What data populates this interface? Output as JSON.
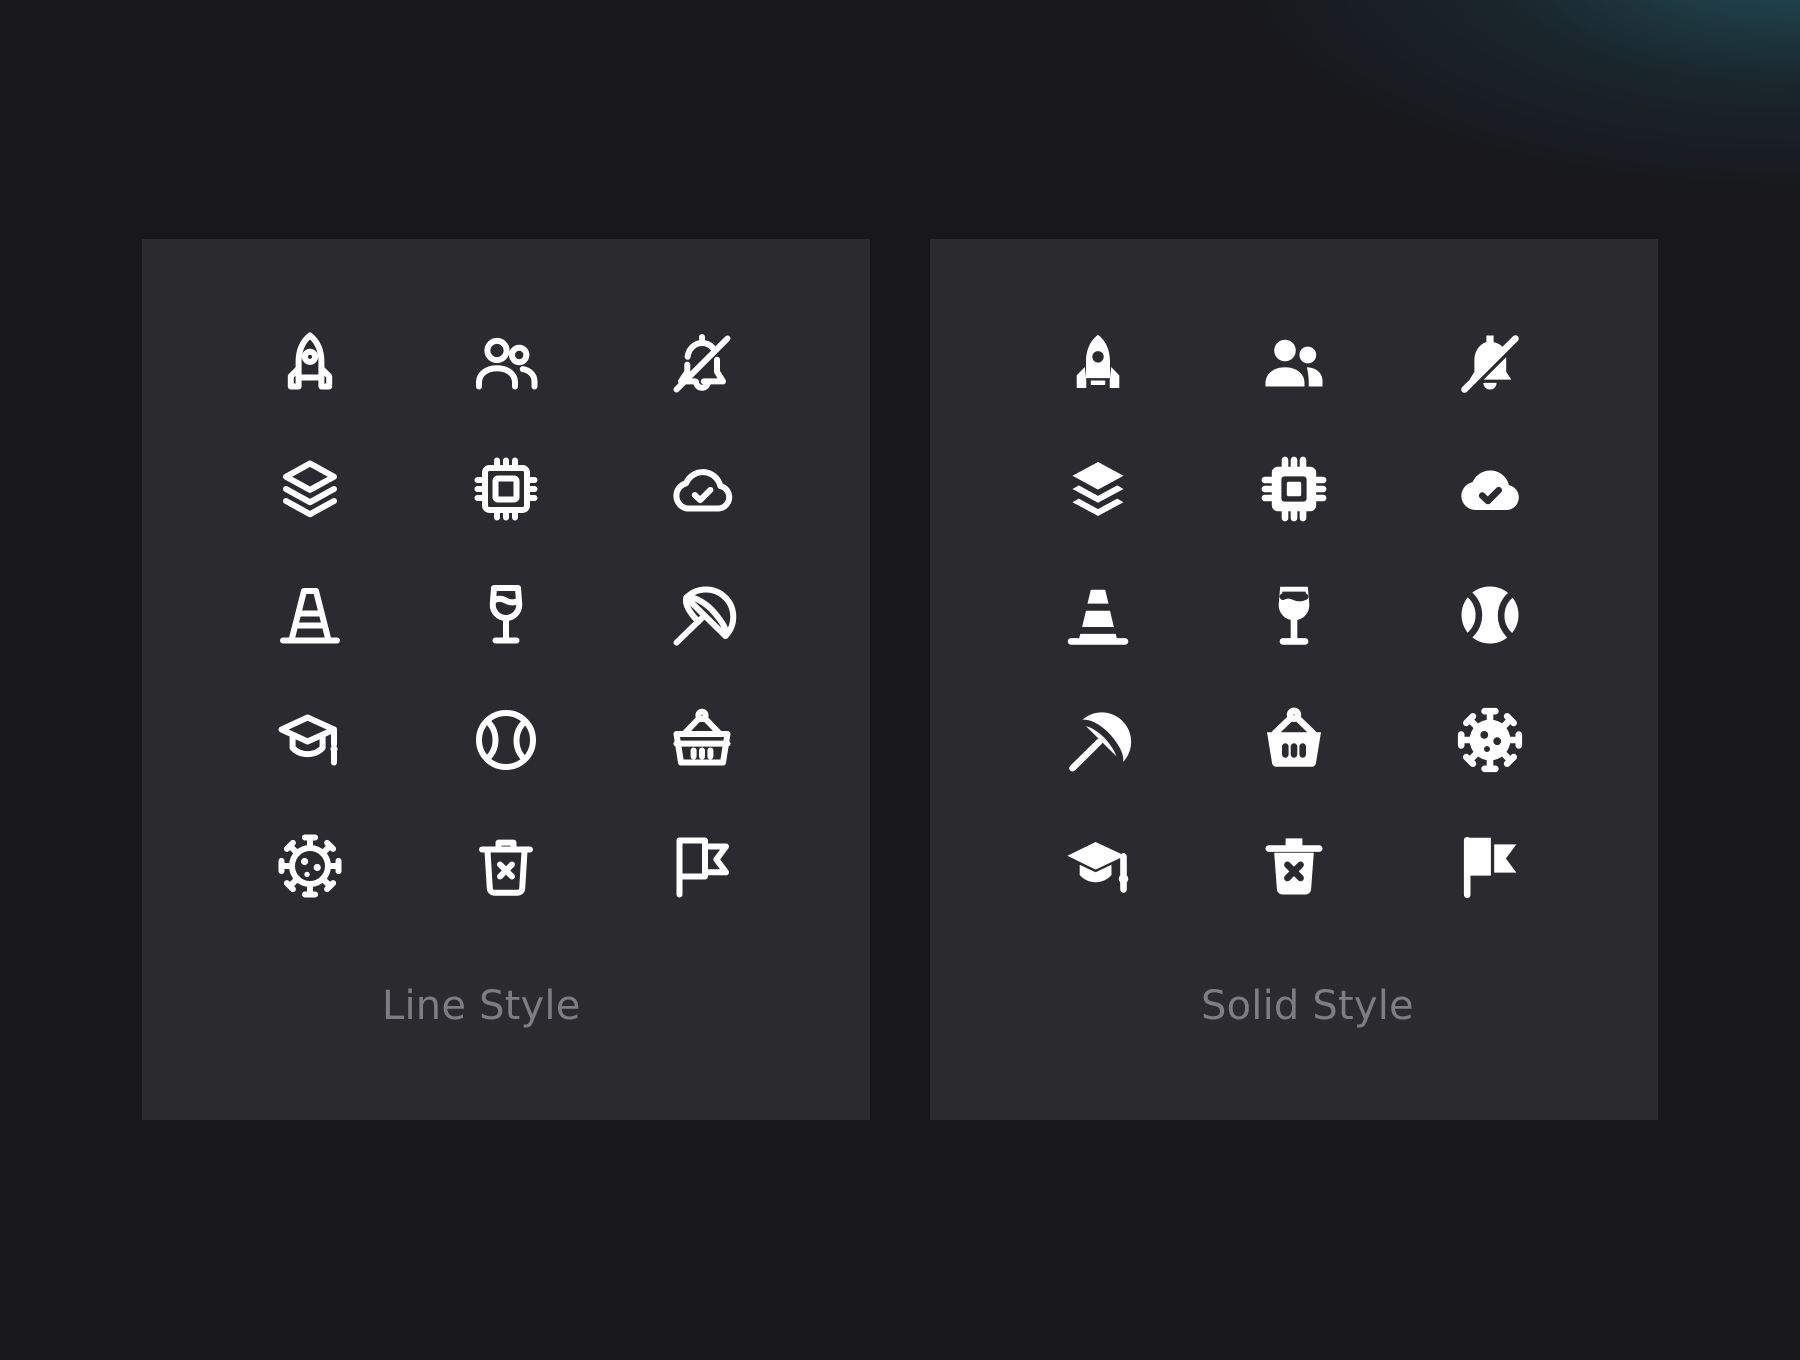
{
  "panels": {
    "line": {
      "label": "Line Style",
      "icons": [
        "rocket-icon",
        "users-icon",
        "bell-off-icon",
        "layers-icon",
        "cpu-chip-icon",
        "cloud-check-icon",
        "traffic-cone-icon",
        "wine-glass-icon",
        "beach-umbrella-icon",
        "graduation-cap-icon",
        "tennis-ball-icon",
        "basket-icon",
        "virus-icon",
        "trash-x-icon",
        "flag-icon"
      ]
    },
    "solid": {
      "label": "Solid Style",
      "icons": [
        "rocket-icon",
        "users-icon",
        "bell-off-icon",
        "layers-icon",
        "cpu-chip-icon",
        "cloud-check-icon",
        "traffic-cone-icon",
        "wine-glass-icon",
        "tennis-ball-icon",
        "beach-umbrella-icon",
        "basket-icon",
        "virus-icon",
        "graduation-cap-icon",
        "trash-x-icon",
        "flag-icon"
      ]
    }
  },
  "colors": {
    "background": "#18181c",
    "card": "#2a2a2f",
    "icon": "#ffffff",
    "label": "#7d7d83",
    "glow": "#266876"
  }
}
